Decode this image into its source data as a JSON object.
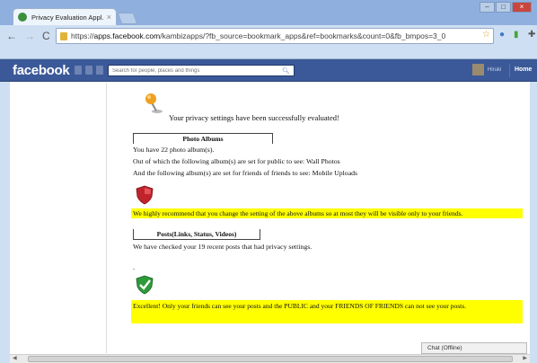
{
  "browser": {
    "tab_title": "Privacy Evaluation Appl...",
    "tab_close": "×",
    "url_prefix": "https://",
    "url_domain": "apps.facebook.com",
    "url_rest": "/kambizapps/?fb_source=bookmark_apps&ref=bookmarks&count=0&fb_bmpos=3_0",
    "win_min": "–",
    "win_max": "□",
    "win_close": "×"
  },
  "facebook": {
    "logo": "facebook",
    "search_placeholder": "Search for people, places and things",
    "user_name": "Hiruki",
    "home": "Home"
  },
  "content": {
    "success_message": "Your privacy settings have been successfully evaluated!",
    "photo_albums_header": "Photo Albums",
    "albums_count": "You have 22 photo album(s).",
    "public_line": "Out of which the following album(s) are set for public to see: Wall Photos",
    "fof_line": "And the following album(s) are set for friends of friends to see: Mobile Uploads",
    "albums_warning": "We highly recommend that you change the setting of the above albums so at most they will be visible only to your friends.",
    "posts_header": "Posts(Links, Status, Videos)",
    "posts_checked": "We have checked your 19 recent posts that had privacy settings.",
    "dot": ".",
    "posts_ok": "Excellent! Only your friends can see your posts and the PUBLIC and your FRIENDS OF FRIENDS can not see your posts."
  },
  "chat": {
    "label": "Chat (Offline)"
  },
  "colors": {
    "facebook_blue": "#3b5998",
    "highlight_yellow": "#ffff00",
    "shield_red": "#c0232b",
    "shield_green": "#2e9a3a"
  }
}
